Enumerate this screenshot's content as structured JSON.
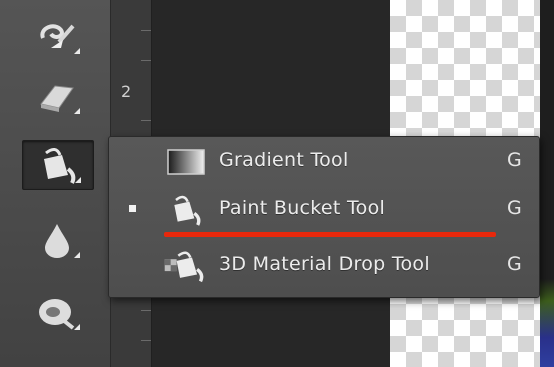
{
  "toolbar": {
    "tools": [
      {
        "name": "brush-tool",
        "icon": "swirl-brush-icon"
      },
      {
        "name": "eraser-tool",
        "icon": "eraser-icon"
      },
      {
        "name": "paint-bucket-tool",
        "icon": "paint-bucket-icon",
        "active": true
      },
      {
        "name": "blur-tool",
        "icon": "water-drop-icon"
      },
      {
        "name": "dodge-tool",
        "icon": "dodge-icon"
      }
    ]
  },
  "ruler": {
    "label": "2"
  },
  "flyout": {
    "items": [
      {
        "label": "Gradient Tool",
        "shortcut": "G",
        "icon": "gradient-icon",
        "selected": false
      },
      {
        "label": "Paint Bucket Tool",
        "shortcut": "G",
        "icon": "paint-bucket-icon",
        "selected": true
      },
      {
        "label": "3D Material Drop Tool",
        "shortcut": "G",
        "icon": "material-drop-icon",
        "selected": false
      }
    ]
  },
  "colors": {
    "highlight_underline": "#e8280c",
    "menu_bg": "#555555",
    "text": "#ececec"
  }
}
